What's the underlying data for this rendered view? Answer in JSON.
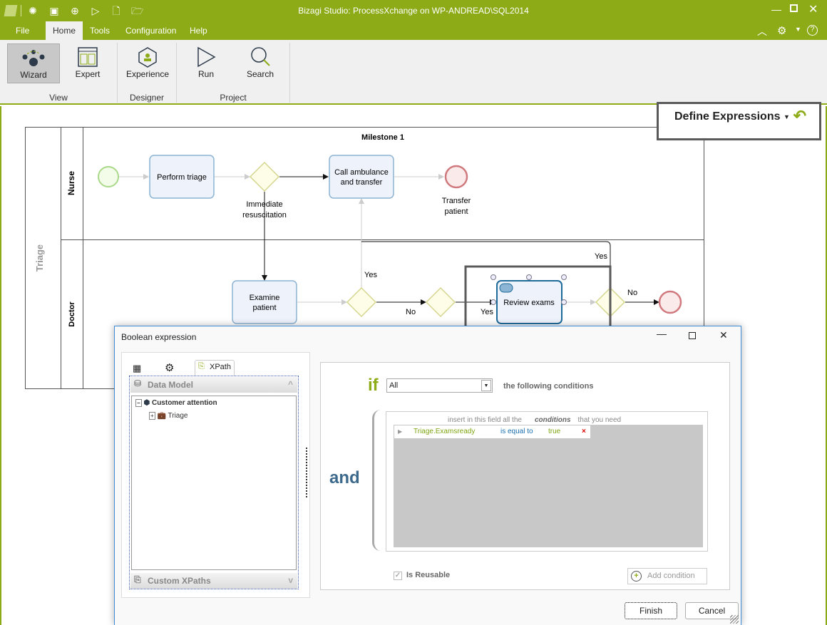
{
  "app": {
    "title": "Bizagi Studio: ProcessXchange  on WP-ANDREAD\\SQL2014",
    "accent": "#8cab17"
  },
  "quick_access": [
    "wizard-icon",
    "expert-icon",
    "save-icon",
    "run-icon",
    "new-file-icon",
    "open-folder-icon"
  ],
  "menu": [
    {
      "label": "File"
    },
    {
      "label": "Home"
    },
    {
      "label": "Tools"
    },
    {
      "label": "Configuration"
    },
    {
      "label": "Help"
    }
  ],
  "ribbon": {
    "buttons": [
      {
        "label": "Wizard"
      },
      {
        "label": "Expert"
      },
      {
        "label": "Experience"
      },
      {
        "label": "Run"
      },
      {
        "label": "Search"
      }
    ],
    "groups": [
      {
        "label": "View"
      },
      {
        "label": "Designer"
      },
      {
        "label": "Project"
      }
    ]
  },
  "define_expressions": {
    "label": "Define Expressions"
  },
  "diagram": {
    "pool": "Triage",
    "milestone": "Milestone 1",
    "lanes": [
      {
        "label": "Nurse"
      },
      {
        "label": "Doctor"
      }
    ],
    "tasks": [
      {
        "label": "Perform triage"
      },
      {
        "label": "Call ambulance and transfer",
        "l1": "Call ambulance",
        "l2": "and transfer"
      },
      {
        "label": "Examine patient",
        "l1": "Examine",
        "l2": "patient"
      },
      {
        "label": "Review exams"
      }
    ],
    "gateway_label": {
      "l1": "Immediate",
      "l2": "resuscitation"
    },
    "end_label": {
      "l1": "Transfer",
      "l2": "patient"
    },
    "flow_labels": {
      "yes1": "Yes",
      "no1": "No",
      "yes2": "Yes",
      "yes3": "Yes",
      "no2": "No"
    }
  },
  "dialog": {
    "title": "Boolean expression",
    "tabs": [
      {
        "icon": "table-icon"
      },
      {
        "icon": "gear-icon"
      },
      {
        "label": "XPath"
      }
    ],
    "data_model": {
      "header": "Data Model",
      "root": "Customer attention",
      "child": "Triage"
    },
    "custom_xpaths": "Custom XPaths",
    "if_label": "if",
    "quantifier": "All",
    "following": "the following conditions",
    "and_label": "and",
    "hint": {
      "a": "insert in this field all the",
      "b": "conditions",
      "c": "that you need"
    },
    "conditions": [
      {
        "field": "Triage.Examsready",
        "operator": "is equal to",
        "value": "true"
      }
    ],
    "is_reusable": {
      "label": "Is Reusable",
      "checked": true
    },
    "add_condition": "Add condition",
    "finish": "Finish",
    "cancel": "Cancel"
  }
}
